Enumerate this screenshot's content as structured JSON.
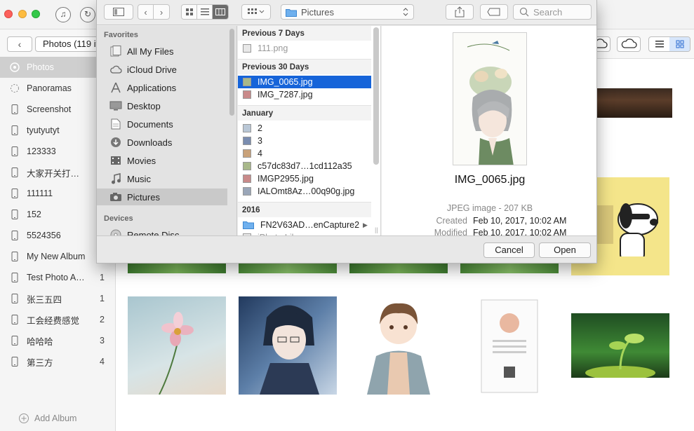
{
  "app": {
    "album_title": "Photos (119 it",
    "selected_album": "Photos",
    "add_album_label": "Add Album",
    "albums": [
      {
        "name": "Photos",
        "count": "",
        "icon": "photos-icon"
      },
      {
        "name": "Panoramas",
        "count": "",
        "icon": "panorama-icon"
      },
      {
        "name": "Screenshot",
        "count": "",
        "icon": "phone-icon"
      },
      {
        "name": "tyutyutyt",
        "count": "",
        "icon": "phone-icon"
      },
      {
        "name": "123333",
        "count": "",
        "icon": "phone-icon"
      },
      {
        "name": "大家开关打…",
        "count": "",
        "icon": "phone-icon"
      },
      {
        "name": "111111",
        "count": "",
        "icon": "phone-icon"
      },
      {
        "name": "152",
        "count": "",
        "icon": "phone-icon"
      },
      {
        "name": "5524356",
        "count": "",
        "icon": "phone-icon"
      },
      {
        "name": "My New Album",
        "count": "",
        "icon": "phone-icon"
      },
      {
        "name": "Test Photo A…",
        "count": "1",
        "icon": "phone-icon"
      },
      {
        "name": "张三五四",
        "count": "1",
        "icon": "phone-icon"
      },
      {
        "name": "工会经费感觉",
        "count": "2",
        "icon": "phone-icon"
      },
      {
        "name": "哈哈哈",
        "count": "3",
        "icon": "phone-icon"
      },
      {
        "name": "第三方",
        "count": "4",
        "icon": "phone-icon"
      }
    ]
  },
  "dialog": {
    "location": "Pictures",
    "search_placeholder": "Search",
    "sidebar": {
      "favorites_header": "Favorites",
      "devices_header": "Devices",
      "favorites": [
        {
          "label": "All My Files",
          "icon": "all-files-icon"
        },
        {
          "label": "iCloud Drive",
          "icon": "cloud-icon"
        },
        {
          "label": "Applications",
          "icon": "applications-icon"
        },
        {
          "label": "Desktop",
          "icon": "desktop-icon"
        },
        {
          "label": "Documents",
          "icon": "document-icon"
        },
        {
          "label": "Downloads",
          "icon": "download-icon"
        },
        {
          "label": "Movies",
          "icon": "movie-icon"
        },
        {
          "label": "Music",
          "icon": "music-icon"
        },
        {
          "label": "Pictures",
          "icon": "camera-icon"
        }
      ],
      "selected": "Pictures",
      "devices": [
        {
          "label": "Remote Disc",
          "icon": "disc-icon"
        }
      ]
    },
    "sections": [
      {
        "header": "Previous 7 Days",
        "files": [
          {
            "name": "111.png",
            "dim": true
          }
        ]
      },
      {
        "header": "Previous 30 Days",
        "files": [
          {
            "name": "IMG_0065.jpg",
            "selected": true
          },
          {
            "name": "IMG_7287.jpg"
          }
        ]
      },
      {
        "header": "January",
        "files": [
          {
            "name": "2"
          },
          {
            "name": "3"
          },
          {
            "name": "4"
          },
          {
            "name": "c57dc83d7…1cd112a35"
          },
          {
            "name": "IMGP2955.jpg"
          },
          {
            "name": "IALOmt8Az…00q90g.jpg"
          }
        ]
      },
      {
        "header": "2016",
        "files": [
          {
            "name": "FN2V63AD…enCapture2",
            "folder": true
          },
          {
            "name": "iPhoto Library",
            "dim": true
          }
        ]
      }
    ],
    "preview": {
      "filename": "IMG_0065.jpg",
      "kind": "JPEG image - 207 KB",
      "created_label": "Created",
      "created_value": "Feb 10, 2017, 10:02 AM",
      "modified_label": "Modified",
      "modified_value": "Feb 10, 2017, 10:02 AM"
    },
    "cancel_label": "Cancel",
    "open_label": "Open"
  },
  "colors": {
    "selection": "#1664d9",
    "close": "#fc605c",
    "minimize": "#fdbc40",
    "zoom": "#34c84a"
  }
}
